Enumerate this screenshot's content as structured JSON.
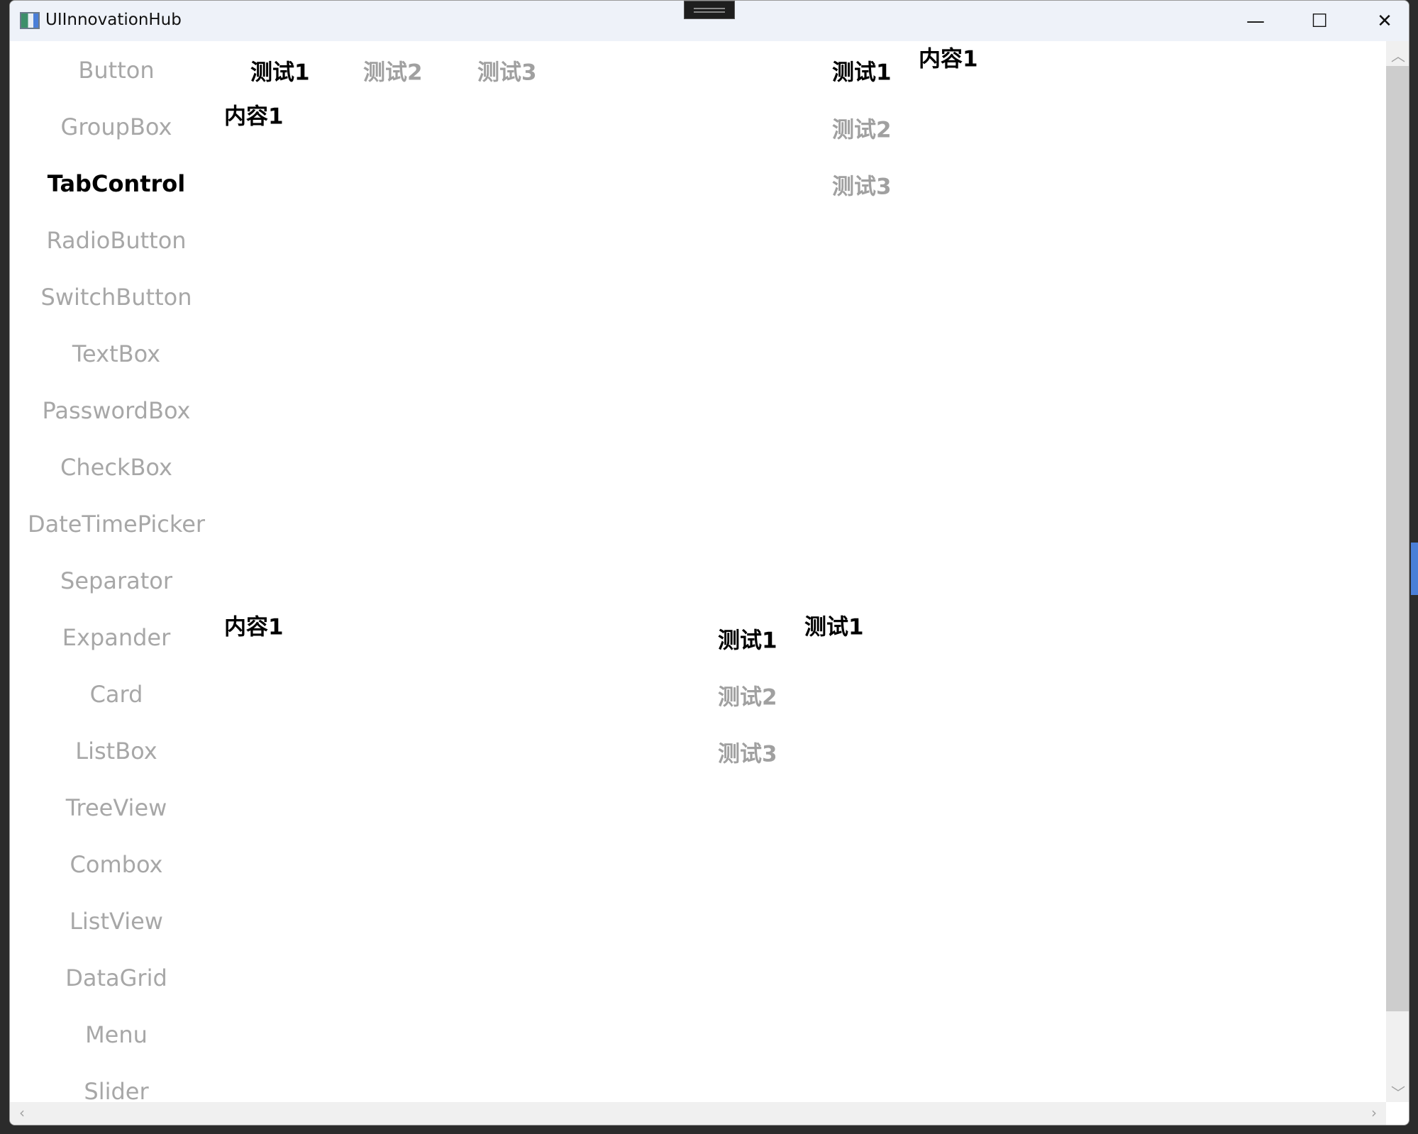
{
  "window": {
    "title": "UIInnovationHub",
    "minimize": "—",
    "maximize": "☐",
    "close": "✕"
  },
  "sidebar": {
    "items": [
      {
        "label": "Button",
        "selected": false
      },
      {
        "label": "GroupBox",
        "selected": false
      },
      {
        "label": "TabControl",
        "selected": true
      },
      {
        "label": "RadioButton",
        "selected": false
      },
      {
        "label": "SwitchButton",
        "selected": false
      },
      {
        "label": "TextBox",
        "selected": false
      },
      {
        "label": "PasswordBox",
        "selected": false
      },
      {
        "label": "CheckBox",
        "selected": false
      },
      {
        "label": "DateTimePicker",
        "selected": false
      },
      {
        "label": "Separator",
        "selected": false
      },
      {
        "label": "Expander",
        "selected": false
      },
      {
        "label": "Card",
        "selected": false
      },
      {
        "label": "ListBox",
        "selected": false
      },
      {
        "label": "TreeView",
        "selected": false
      },
      {
        "label": "Combox",
        "selected": false
      },
      {
        "label": "ListView",
        "selected": false
      },
      {
        "label": "DataGrid",
        "selected": false
      },
      {
        "label": "Menu",
        "selected": false
      },
      {
        "label": "Slider",
        "selected": false
      }
    ]
  },
  "tabs_top": {
    "tabs": [
      "测试1",
      "测试2",
      "测试3"
    ],
    "content": "内容1"
  },
  "tabs_left": {
    "tabs": [
      "测试1",
      "测试2",
      "测试3"
    ],
    "content": "内容1"
  },
  "tabs_bottom": {
    "content": "内容1"
  },
  "tabs_right": {
    "tabs": [
      "测试1",
      "测试2",
      "测试3"
    ],
    "content": "测试1"
  },
  "scrollbar": {
    "up": "︿",
    "down": "﹀",
    "left": "‹",
    "right": "›"
  },
  "colors": {
    "titlebar": "#eef2f9",
    "selected": "#000000",
    "unselected": "#a7a7a7",
    "accent": "#4a7fd8"
  }
}
